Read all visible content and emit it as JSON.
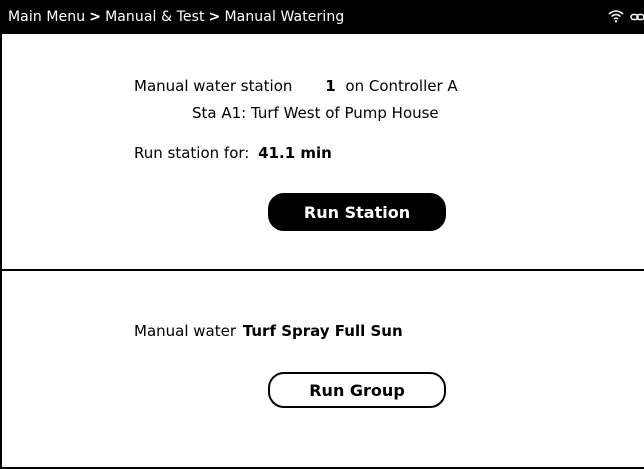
{
  "header": {
    "breadcrumb": [
      "Main Menu",
      "Manual & Test",
      "Manual Watering"
    ],
    "separator": ">",
    "status_icons": [
      "wifi-icon",
      "link-icon"
    ]
  },
  "station": {
    "prefix": "Manual water station",
    "number": "1",
    "controller_text": "on Controller A",
    "name": "Sta A1: Turf West of Pump House",
    "run_label": "Run station for:",
    "run_value": "41.1 min",
    "button_label": "Run Station"
  },
  "group": {
    "prefix": "Manual water",
    "name": "Turf Spray Full Sun",
    "button_label": "Run Group"
  },
  "colors": {
    "header_bg": "#000000",
    "header_text": "#ffffff",
    "background": "#ffffff"
  }
}
